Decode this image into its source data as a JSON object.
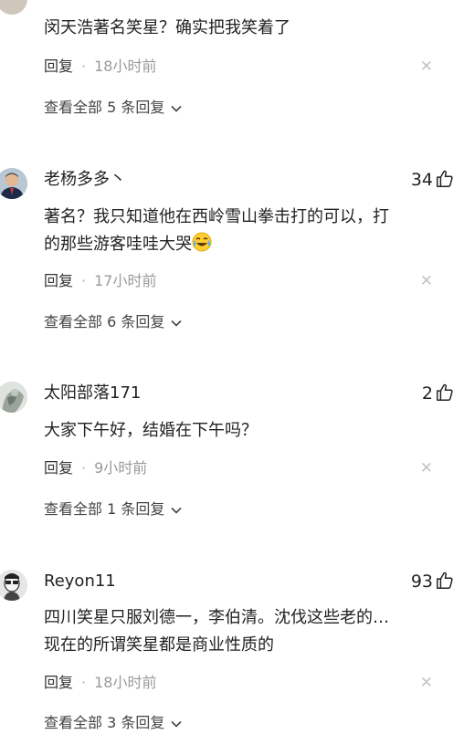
{
  "comments": [
    {
      "username": "",
      "likes": "",
      "text": "闵天浩著名笑星？确实把我笑着了",
      "reply_label": "回复",
      "time": "18小时前",
      "view_all": "查看全部 5 条回复"
    },
    {
      "username": "老杨多多丶",
      "likes": "34",
      "text": "著名？我只知道他在西岭雪山拳击打的可以，打\n的那些游客哇哇大哭",
      "emoji": "crying-laughing-emoji",
      "reply_label": "回复",
      "time": "17小时前",
      "view_all": "查看全部 6 条回复"
    },
    {
      "username": "太阳部落171",
      "likes": "2",
      "text": "大家下午好，结婚在下午吗？",
      "reply_label": "回复",
      "time": "9小时前",
      "view_all": "查看全部 1 条回复"
    },
    {
      "username": "Reyon11",
      "likes": "93",
      "text": "四川笑星只服刘德一，李伯清。沈伐这些老的…\n现在的所谓笑星都是商业性质的",
      "reply_label": "回复",
      "time": "18小时前",
      "view_all": "查看全部 3 条回复"
    }
  ],
  "separator": "·",
  "icons": {
    "like": "thumbs-up-icon",
    "close": "close-icon",
    "expand": "chevron-down-icon"
  }
}
